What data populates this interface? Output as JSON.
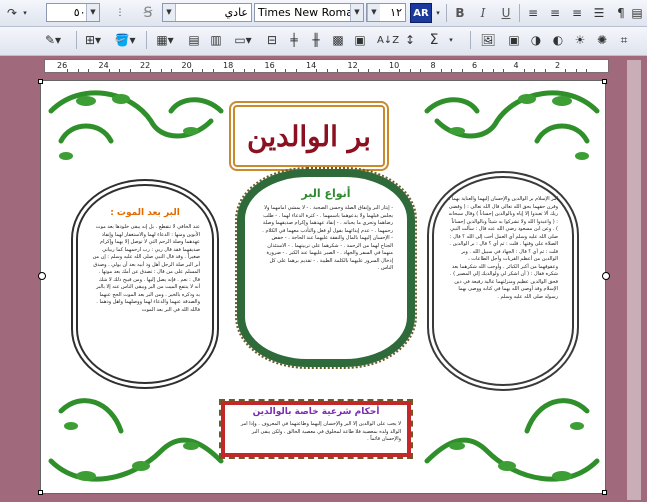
{
  "toolbar1": {
    "zoom_value": "%٥٠",
    "style_value": "عادي",
    "font_value": "Times New Roman",
    "size_value": "١٢",
    "direction_label": "AR",
    "bold_label": "B",
    "italic_label": "I",
    "underline_label": "U",
    "brush_label": "A̲"
  },
  "toolbar2": {
    "sigma_label": "Σ",
    "sort_label": "A↓Z"
  },
  "ruler": {
    "labels": [
      "26",
      "24",
      "22",
      "20",
      "18",
      "16",
      "14",
      "12",
      "10",
      "8",
      "6",
      "4",
      "2"
    ]
  },
  "document": {
    "title": "بر الوالدين",
    "left_heading": "البر بعد الموت :",
    "center_heading": "أنواع البر",
    "bottom_heading": "أحكام شرعية خاصة بالوالدين",
    "left_text": "عند الحاقي لا تنقطع . بل إنه يبقى خلودها بعد موت الأبوين ومنها : الدعاء لهما والاستغفار لهما وإنفاذ عهدهما وصلة الرحم التي لا توصل إلا بهما وإكرام صديقهما فقد قال ربي : رب ارحمهما كما ربياني صغيراً . وقد قال النبي صلى الله عليه وسلم : إن من أبر البر صلة الرجل أهل ود أبيه بعد أن يولي . وصدق المسلم على من قال : تصدق عن أمك بعد موتها . قال : نعم . فإنه يصل إليها . ومن قبيح ذلك لا شك أنه لا ينتفع الميت من البر ويبقى الناس عنه إلا بالبر به وذكره بالخير . ومن البر بعد الموت الحج عنهما والصدقة عنهما والدعاء لهما ووصلهما واهل ودهما . فالله الله في البر بعد الموت",
    "center_text": "- إيثار البر وإنفاق الصلة وحسن الصحبة . - لا يمشي أمامهما ولا يجلس قبلهما ولا يدعوهما باسمهما . - كثرة الدعاء لهما . - طلب رضاهما وتحري ما يحبانه . - إنفاذ عهدهما وإكرام صديقهما وصلة رحمهما . - عدم إيذائهما بقول أو فعل والتأدب معهما في الكلام . - الإحسان إليهما بالمال والنفقة عليهما عند الحاجة . - خفض الجناح لهما من الرحمة . - شكرهما على تربيتهما . - الاستئذان منهما في السفر والجهاد . - الصبر عليهما عند الكبر . - ضرورة إدخال السرور عليهما بالكلمة الطيبة . - تقديم برهما على كل الناس .",
    "right_text": "أمر الإسلام بر الوالدين والإحسان إليهما والعناية بهما ، وقرن حقهما بحق الله تعالى قال الله تعالى : ( وقضى ربك ألا تعبدوا إلا إياه وبالوالدين إحساناً ) وقال سبحانه : ( واعبدوا الله ولا تشركوا به شيئاً وبالوالدين إحساناً ) . وعن ابن مسعود رضي الله عنه قال : سألت النبي صلى الله عليه وسلم أي العمل أحب إلى الله ؟ قال : الصلاة على وقتها . قلت : ثم أي ؟ قال : بر الوالدين . قلت : ثم أي ؟ قال : الجهاد في سبيل الله . وبر الوالدين من أعظم القربات وأجل الطاعات ، وعقوقهما من أكبر الكبائر . وأوجب الله شكرهما بعد شكره فقال : ( أن اشكر لي ولوالديك إلي المصير ) . فحق الوالدين عظيم ومنزلتهما عالية رفيعة في دين الإسلام وقد أوصى الله بهما في كتابه ووصى بهما رسوله صلى الله عليه وسلم .",
    "bottom_text": "لا يجب على الوالدين إلا البر والإحسان إليهما وطاعتهما في المعروف . وإذا أمر الوالد ولده بمعصية فلا طاعة لمخلوق في معصية الخالق ، ولكن يبقى البر والإحسان قائماً ."
  },
  "colors": {
    "title": "#8b1020",
    "heading_orange": "#e56a00",
    "heading_purple": "#7b2bb5",
    "vine_green": "#2f8f2a",
    "workspace": "#a06a7c"
  }
}
